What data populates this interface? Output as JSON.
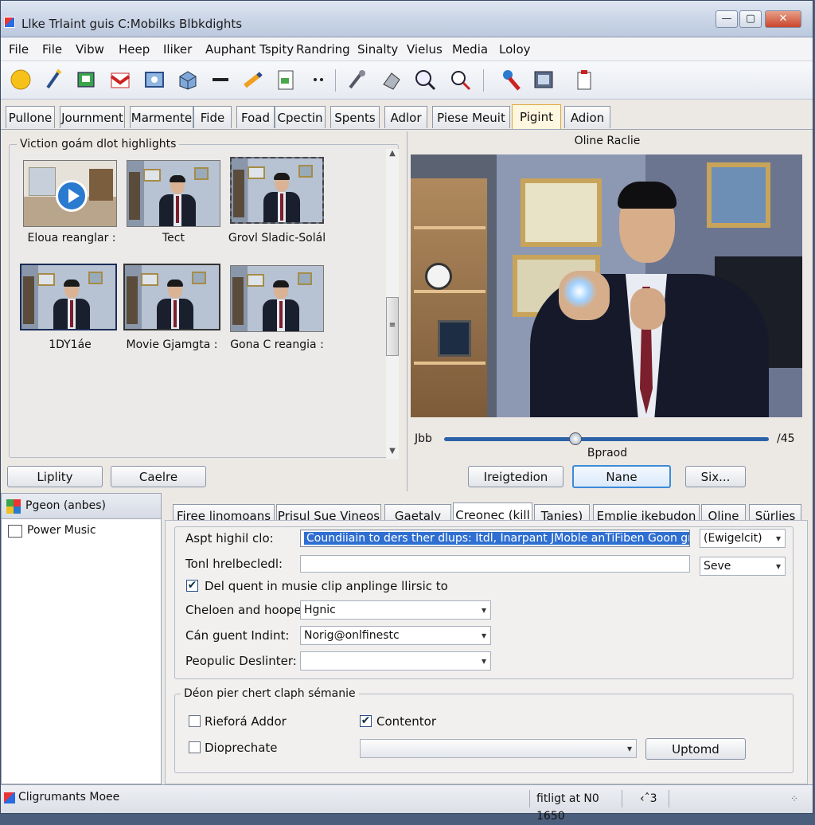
{
  "window": {
    "title": "Llke Trlaint guis C:Mobilks Blbkdights",
    "btn_min": "—",
    "btn_max": "▢",
    "btn_close": "✕"
  },
  "menu": [
    "File",
    "File",
    "Vibw",
    "Heep",
    "Iliker",
    "Auphant Tspity",
    "Randring",
    "Sinalty",
    "Vielus",
    "Media",
    "Loloy"
  ],
  "toolbar_icons": [
    "smiley-icon",
    "wand-icon",
    "green-page-icon",
    "gift-icon",
    "photo-icon",
    "cube-icon",
    "dash-icon",
    "pen-icon",
    "document-icon",
    "ellipsis-icon",
    "pipette-icon",
    "eraser-icon",
    "zoom-icon",
    "search-icon",
    "red-brush-icon",
    "film-icon",
    "clipboard-icon"
  ],
  "tabs_top": [
    {
      "label": "Pullone",
      "active": false
    },
    {
      "label": "Journment",
      "active": false
    },
    {
      "label": "Marmente",
      "active": false
    },
    {
      "label": "Fide",
      "active": false
    },
    {
      "label": "Foad",
      "active": false
    },
    {
      "label": "Cpectin",
      "active": false
    },
    {
      "label": "Spents",
      "active": false
    },
    {
      "label": "Adlor",
      "active": false
    },
    {
      "label": "Piese Meuit",
      "active": false
    },
    {
      "label": "Pigint",
      "active": true
    },
    {
      "label": "Adion",
      "active": false
    }
  ],
  "gallery": {
    "title": "Viction goám dlot highlights",
    "items": [
      {
        "caption": "Eloua reanglar :",
        "kind": "room-play"
      },
      {
        "caption": "Tect",
        "kind": "person"
      },
      {
        "caption": "Grovl Sladic-Solál",
        "kind": "person"
      },
      {
        "caption": "1DY1áe",
        "kind": "person"
      },
      {
        "caption": "Movie Gjamgta :",
        "kind": "person"
      },
      {
        "caption": "Gona C reangia :",
        "kind": "person"
      }
    ],
    "btn_left": "Liplity",
    "btn_right": "Caelre"
  },
  "preview": {
    "title": "Oline Raclie",
    "time_start": "Jbb",
    "time_end": "/45",
    "slider_label": "Bpraod",
    "position": 0.4,
    "btn1": "Ireigtedion",
    "btn2": "Nane",
    "btn3": "Six..."
  },
  "sidebar": {
    "header": "Pgeon (anbes)",
    "items": [
      "Power Music"
    ]
  },
  "tabs_bottom": [
    {
      "label": "Firee linomoans",
      "active": false
    },
    {
      "label": "Prisul Sue Vineos",
      "active": false
    },
    {
      "label": "Gaetaly",
      "active": false
    },
    {
      "label": "Creonec (kill",
      "active": true
    },
    {
      "label": "Tanies)",
      "active": false
    },
    {
      "label": "Emplie ikebudon",
      "active": false
    },
    {
      "label": "Oline",
      "active": false
    },
    {
      "label": "Sürlies",
      "active": false
    }
  ],
  "form": {
    "row1_label": "Aspt highil clo:",
    "row1_value": "Coundiiain to ders ther dlups: Itdl, Inarpant JMoble anTiFiben Goon gno",
    "row1_combo": "(Ewigelcit)",
    "row2_label": "Tonl hrelbecledl:",
    "row2_value": "",
    "row2_combo": "Seve",
    "check1_label": "Del quent in musie clip anplinge llirsic to",
    "check1_checked": true,
    "row3_label": "Cheloen and hoopes:",
    "row3_value": "Hgnic",
    "row4_label": "Cán guent Indint:",
    "row4_value": "Norig@onlfinestc",
    "row5_label": "Peopulic Deslinter:",
    "row5_value": ""
  },
  "group2": {
    "title": "Déon pier chert claph sémanie",
    "check_a": "Rieforá Addor",
    "check_a_checked": false,
    "check_b": "Contentor",
    "check_b_checked": true,
    "check_c": "Dioprechate",
    "check_c_checked": false,
    "combo_value": "",
    "button": "Uptomd"
  },
  "status": {
    "left": "Cligrumants Moee",
    "middle": "fitligt at N0 1650",
    "right": "‹ˆ3"
  }
}
